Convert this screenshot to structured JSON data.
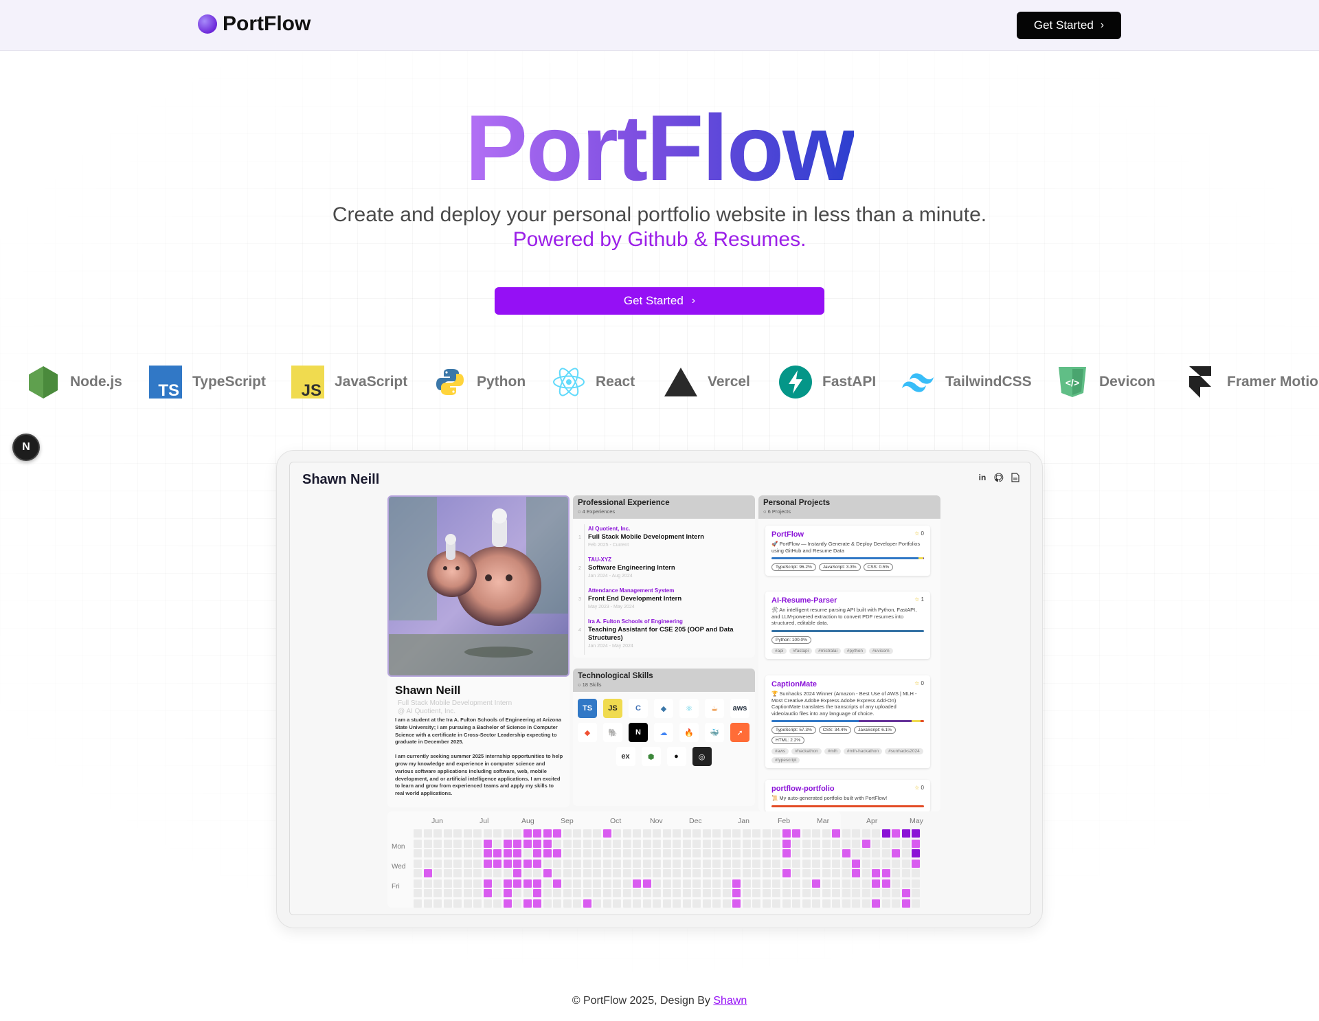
{
  "header": {
    "brand": "PortFlow",
    "cta_label": "Get Started",
    "cta_icon": "chevron-right-icon"
  },
  "hero": {
    "title": "PortFlow",
    "subtitle": "Create and deploy your personal portfolio website in less than a minute.",
    "tagline": "Powered by Github & Resumes.",
    "cta_label": "Get Started",
    "colors": {
      "title_start": "#b370f5",
      "title_end": "#2d3fcf",
      "cta": "#9510f5",
      "tagline": "#9b1fe8"
    }
  },
  "technologies": [
    {
      "label": "Node.js",
      "icon": "nodejs-icon"
    },
    {
      "label": "TypeScript",
      "icon": "typescript-icon"
    },
    {
      "label": "JavaScript",
      "icon": "javascript-icon"
    },
    {
      "label": "Python",
      "icon": "python-icon"
    },
    {
      "label": "React",
      "icon": "react-icon"
    },
    {
      "label": "Vercel",
      "icon": "vercel-icon"
    },
    {
      "label": "FastAPI",
      "icon": "fastapi-icon"
    },
    {
      "label": "TailwindCSS",
      "icon": "tailwind-icon"
    },
    {
      "label": "Devicon",
      "icon": "devicon-icon"
    },
    {
      "label": "Framer Motion",
      "icon": "framer-icon"
    }
  ],
  "floating_badge": "N",
  "preview": {
    "name": "Shawn Neill",
    "header_icons": [
      "linkedin-icon",
      "github-icon",
      "resume-icon"
    ],
    "profile": {
      "name": "Shawn Neill",
      "role": "Full Stack Mobile Development Intern",
      "company": "@ AI Quotient, Inc.",
      "bio": [
        "I am a student at the Ira A. Fulton Schools of Engineering at Arizona State University; I am pursuing a Bachelor of Science in Computer Science with a certificate in Cross-Sector Leadership expecting to graduate in December 2025.",
        "I am currently seeking summer 2025 internship opportunities to help grow my knowledge and experience in computer science and various software applications including software, web, mobile development, and or artificial intelligence applications. I am excited to learn and grow from experienced teams and apply my skills to real world applications."
      ]
    },
    "experience": {
      "title": "Professional Experience",
      "count": "4 Experiences",
      "items": [
        {
          "company": "AI Quotient, Inc.",
          "role": "Full Stack Mobile Development Intern",
          "date": "Feb 2025 - Current"
        },
        {
          "company": "TAU-XYZ",
          "role": "Software Engineering Intern",
          "date": "Jan 2024 - Aug 2024"
        },
        {
          "company": "Attendance Management System",
          "role": "Front End Development Intern",
          "date": "May 2023 - May 2024"
        },
        {
          "company": "Ira A. Fulton Schools of Engineering",
          "role": "Teaching Assistant for CSE 205 (OOP and Data Structures)",
          "date": "Jan 2024 - May 2024"
        }
      ]
    },
    "skills": {
      "title": "Technological Skills",
      "count": "18 Skills",
      "items": [
        {
          "icon": "typescript-icon",
          "text": "TS",
          "bg": "#3178c6",
          "fg": "#ffffff"
        },
        {
          "icon": "javascript-icon",
          "text": "JS",
          "bg": "#f0db4f",
          "fg": "#222222"
        },
        {
          "icon": "c-icon",
          "text": "C",
          "bg": "#ffffff",
          "fg": "#3e6fb4"
        },
        {
          "icon": "python-icon",
          "text": "◆",
          "bg": "#ffffff",
          "fg": "#3b77a8"
        },
        {
          "icon": "react-icon",
          "text": "⚛",
          "bg": "#ffffff",
          "fg": "#3ec5e0"
        },
        {
          "icon": "java-icon",
          "text": "☕",
          "bg": "#ffffff",
          "fg": "#e76f00"
        },
        {
          "icon": "aws-icon",
          "text": "aws",
          "bg": "#ffffff",
          "fg": "#232f3e"
        },
        {
          "icon": "git-icon",
          "text": "◆",
          "bg": "#ffffff",
          "fg": "#f05133"
        },
        {
          "icon": "postgresql-icon",
          "text": "🐘",
          "bg": "#ffffff",
          "fg": "#336791"
        },
        {
          "icon": "nextjs-icon",
          "text": "N",
          "bg": "#000000",
          "fg": "#ffffff"
        },
        {
          "icon": "gcp-icon",
          "text": "☁",
          "bg": "#ffffff",
          "fg": "#4285f4"
        },
        {
          "icon": "firebase-icon",
          "text": "🔥",
          "bg": "#ffffff",
          "fg": "#ffa000"
        },
        {
          "icon": "docker-icon",
          "text": "🐳",
          "bg": "#ffffff",
          "fg": "#2496ed"
        },
        {
          "icon": "postman-icon",
          "text": "➚",
          "bg": "#ff6c37",
          "fg": "#ffffff"
        },
        {
          "icon": "express-icon",
          "text": "ex",
          "bg": "#ffffff",
          "fg": "#333333"
        },
        {
          "icon": "nodejs-icon",
          "text": "⬢",
          "bg": "#ffffff",
          "fg": "#3c873a"
        },
        {
          "icon": "github-icon",
          "text": "●",
          "bg": "#ffffff",
          "fg": "#111111"
        },
        {
          "icon": "ollama-icon",
          "text": "◎",
          "bg": "#222222",
          "fg": "#ffffff"
        }
      ]
    },
    "projects": {
      "title": "Personal Projects",
      "count": "6 Projects",
      "items": [
        {
          "name": "PortFlow",
          "stars": "0",
          "desc": "🚀 PortFlow — Instantly Generate & Deploy Developer Portfolios using GitHub and Resume Data",
          "langs": [
            {
              "label": "TypeScript: 96.2%",
              "pct": 96.2,
              "color": "#3178c6"
            },
            {
              "label": "JavaScript: 3.3%",
              "pct": 3.3,
              "color": "#f0db4f"
            },
            {
              "label": "CSS: 0.5%",
              "pct": 0.5,
              "color": "#663399"
            }
          ],
          "tags": []
        },
        {
          "name": "AI-Resume-Parser",
          "stars": "1",
          "desc": "🛠 An intelligent resume parsing API built with Python, FastAPI, and LLM-powered extraction to convert PDF resumes into structured, editable data.",
          "langs": [
            {
              "label": "Python: 100.0%",
              "pct": 100,
              "color": "#3572a5"
            }
          ],
          "tags": [
            "#api",
            "#fastapi",
            "#mistralai",
            "#python",
            "#uvicorn"
          ]
        },
        {
          "name": "CaptionMate",
          "stars": "0",
          "desc": "🏆 Sunhacks 2024 Winner (Amazon - Best Use of AWS | MLH - Most Creative Adobe Express Adobe Express Add-On) CaptionMate translates the transcripts of any uploaded video/audio files into any language of choice.",
          "langs": [
            {
              "label": "TypeScript: 57.3%",
              "pct": 57.3,
              "color": "#3178c6"
            },
            {
              "label": "CSS: 34.4%",
              "pct": 34.4,
              "color": "#663399"
            },
            {
              "label": "JavaScript: 6.1%",
              "pct": 6.1,
              "color": "#f0db4f"
            },
            {
              "label": "HTML: 2.2%",
              "pct": 2.2,
              "color": "#e34c26"
            }
          ],
          "tags": [
            "#aws",
            "#hackathon",
            "#mlh",
            "#mlh-hackathon",
            "#sunhacks2024",
            "#typescript"
          ]
        },
        {
          "name": "portflow-portfolio",
          "stars": "0",
          "desc": "📜 My auto-generated portfolio built with PortFlow!",
          "langs": [
            {
              "label": "",
              "pct": 100,
              "color": "#e34c26"
            }
          ],
          "tags": []
        }
      ]
    },
    "contributions": {
      "months": [
        "Jun",
        "Jul",
        "Aug",
        "Sep",
        "Oct",
        "Nov",
        "Dec",
        "Jan",
        "Feb",
        "Mar",
        "Apr",
        "May"
      ],
      "days": [
        "Mon",
        "Wed",
        "Fri"
      ],
      "active": [
        [
          1,
          4
        ],
        [
          7,
          1
        ],
        [
          7,
          2
        ],
        [
          7,
          3
        ],
        [
          7,
          5
        ],
        [
          7,
          6
        ],
        [
          8,
          2
        ],
        [
          8,
          3
        ],
        [
          9,
          1
        ],
        [
          9,
          2
        ],
        [
          9,
          3
        ],
        [
          9,
          5
        ],
        [
          9,
          6
        ],
        [
          9,
          7
        ],
        [
          10,
          1
        ],
        [
          10,
          2
        ],
        [
          10,
          3
        ],
        [
          10,
          4
        ],
        [
          10,
          5
        ],
        [
          11,
          0
        ],
        [
          11,
          1
        ],
        [
          11,
          3
        ],
        [
          11,
          5
        ],
        [
          11,
          7
        ],
        [
          12,
          0
        ],
        [
          12,
          1
        ],
        [
          12,
          2
        ],
        [
          12,
          3
        ],
        [
          12,
          5
        ],
        [
          12,
          6
        ],
        [
          12,
          7
        ],
        [
          13,
          0
        ],
        [
          13,
          1
        ],
        [
          13,
          2
        ],
        [
          13,
          4
        ],
        [
          14,
          0
        ],
        [
          14,
          2
        ],
        [
          14,
          5
        ],
        [
          17,
          7
        ],
        [
          19,
          0
        ],
        [
          22,
          5
        ],
        [
          23,
          5
        ],
        [
          32,
          5
        ],
        [
          32,
          6
        ],
        [
          32,
          7
        ],
        [
          37,
          0
        ],
        [
          37,
          1
        ],
        [
          37,
          2
        ],
        [
          37,
          4
        ],
        [
          38,
          0
        ],
        [
          40,
          5
        ],
        [
          42,
          0
        ],
        [
          43,
          2
        ],
        [
          44,
          3
        ],
        [
          44,
          4
        ],
        [
          45,
          1
        ],
        [
          46,
          4
        ],
        [
          46,
          5
        ],
        [
          46,
          7
        ],
        [
          47,
          0
        ],
        [
          47,
          4
        ],
        [
          47,
          5
        ],
        [
          48,
          0
        ],
        [
          48,
          2
        ],
        [
          49,
          6
        ],
        [
          49,
          7
        ],
        [
          50,
          0
        ],
        [
          50,
          1
        ],
        [
          50,
          2
        ],
        [
          50,
          3
        ]
      ],
      "dark": [
        [
          47,
          0
        ],
        [
          49,
          0
        ],
        [
          50,
          0
        ],
        [
          50,
          2
        ]
      ]
    }
  },
  "footer": {
    "text": "© PortFlow 2025, Design By",
    "link": "Shawn"
  }
}
